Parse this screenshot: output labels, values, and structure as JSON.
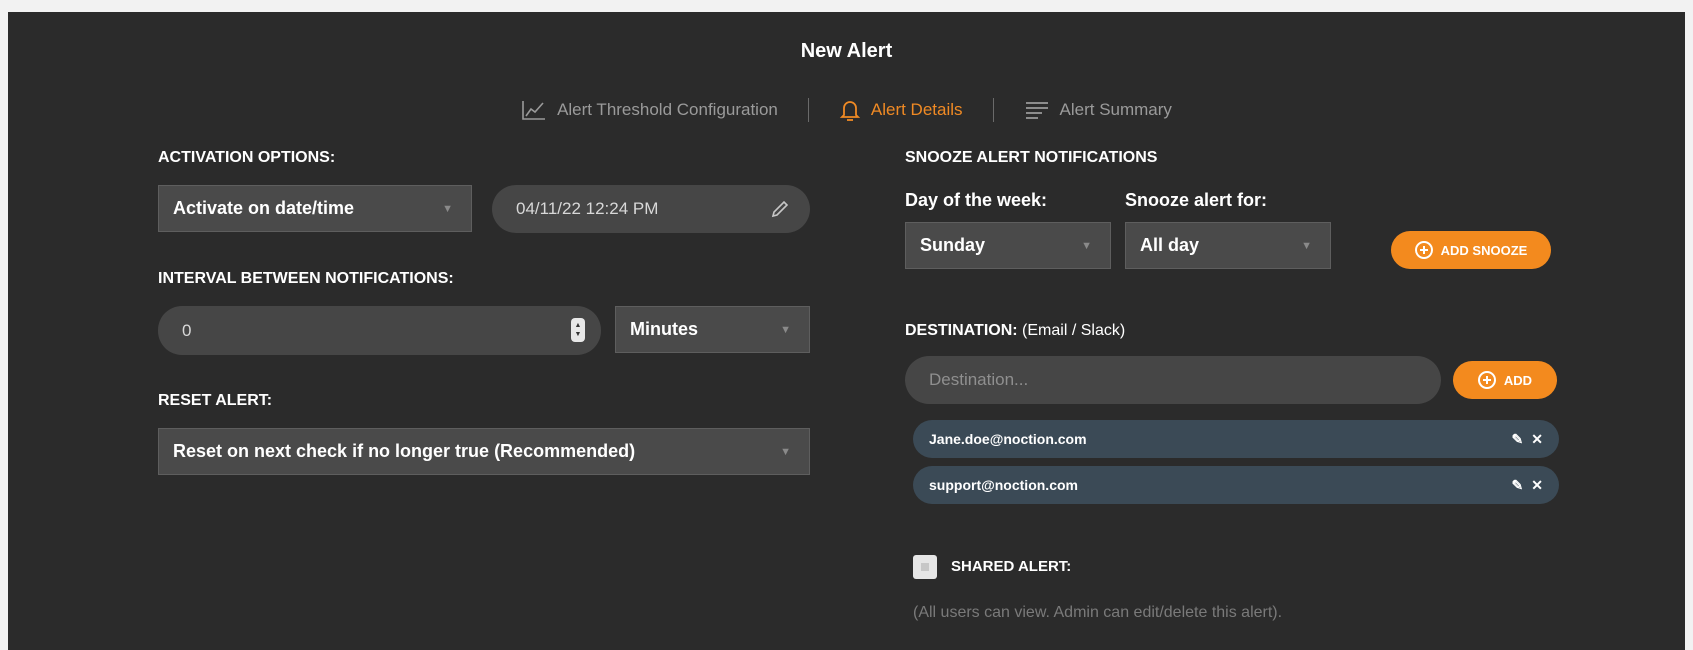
{
  "dialog": {
    "title": "New Alert"
  },
  "steps": [
    {
      "label": "Alert Threshold Configuration",
      "icon": "chart-icon"
    },
    {
      "label": "Alert Details",
      "icon": "bell-icon"
    },
    {
      "label": "Alert Summary",
      "icon": "lines-icon"
    }
  ],
  "colors": {
    "accent": "#f08a24",
    "panel": "#2b2b2b",
    "tag": "#3b4a56"
  },
  "activation": {
    "label": "ACTIVATION OPTIONS:",
    "mode": "Activate on date/time",
    "datetime": "04/11/22 12:24 PM"
  },
  "interval": {
    "label": "INTERVAL BETWEEN NOTIFICATIONS:",
    "value": "0",
    "unit": "Minutes"
  },
  "reset": {
    "label": "RESET ALERT:",
    "option": "Reset on next check if no longer true (Recommended)"
  },
  "snooze": {
    "title": "SNOOZE ALERT NOTIFICATIONS",
    "day_label": "Day of the week:",
    "day_value": "Sunday",
    "for_label": "Snooze alert for:",
    "for_value": "All day",
    "add_label": "ADD SNOOZE"
  },
  "destination": {
    "label_bold": "DESTINATION:",
    "label_hint": "(Email / Slack)",
    "placeholder": "Destination...",
    "add_label": "ADD",
    "items": [
      "Jane.doe@noction.com",
      "support@noction.com"
    ]
  },
  "shared": {
    "label": "SHARED ALERT:",
    "note": "(All users can view. Admin can edit/delete this alert)."
  }
}
